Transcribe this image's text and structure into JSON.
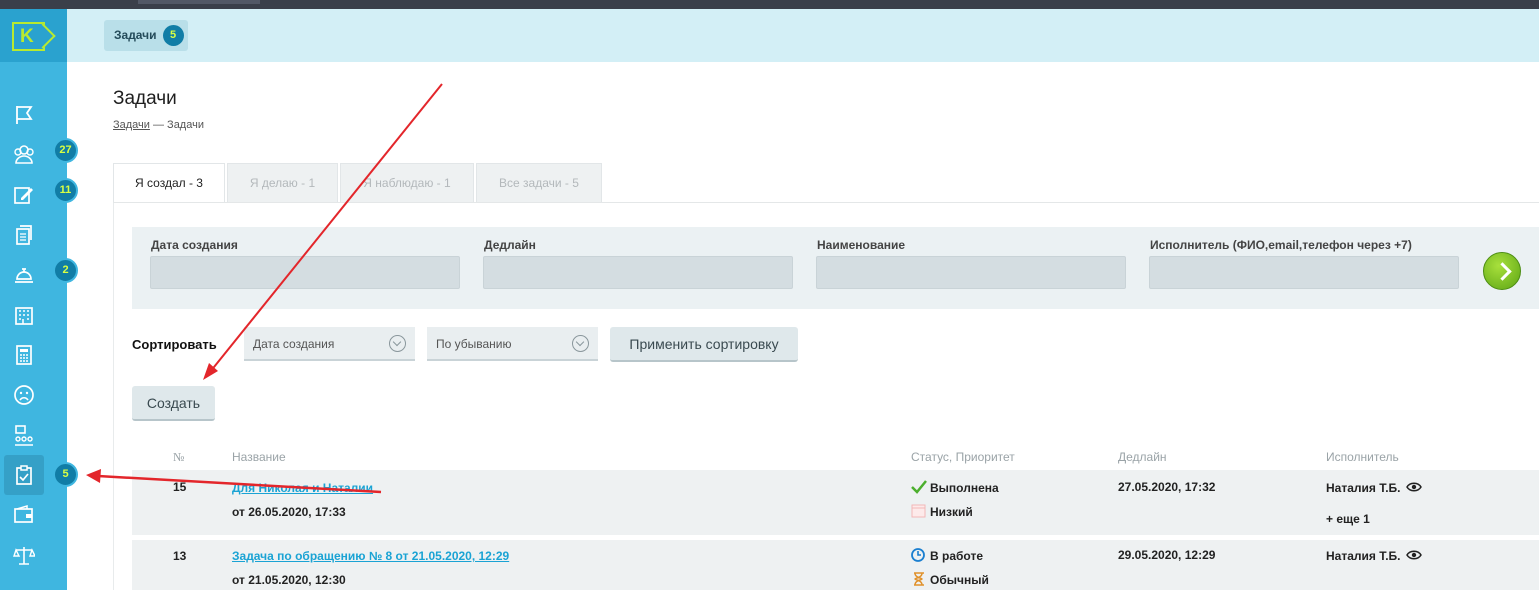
{
  "header": {
    "chip_label": "Задачи",
    "chip_count": "5"
  },
  "sidebar": {
    "logo_letter": "K",
    "items": [
      {
        "icon": "flag-icon",
        "badge": ""
      },
      {
        "icon": "users-group-icon",
        "badge": "27"
      },
      {
        "icon": "edit-note-icon",
        "badge": "11"
      },
      {
        "icon": "documents-icon",
        "badge": ""
      },
      {
        "icon": "concierge-bell-icon",
        "badge": "2"
      },
      {
        "icon": "building-icon",
        "badge": ""
      },
      {
        "icon": "calculator-icon",
        "badge": ""
      },
      {
        "icon": "sad-face-icon",
        "badge": ""
      },
      {
        "icon": "org-structure-icon",
        "badge": ""
      },
      {
        "icon": "clipboard-check-icon",
        "badge": "5"
      },
      {
        "icon": "wallet-icon",
        "badge": ""
      },
      {
        "icon": "scales-icon",
        "badge": ""
      }
    ]
  },
  "page": {
    "title": "Задачи",
    "breadcrumb_link": "Задачи",
    "breadcrumb_rest": " — Задачи"
  },
  "tabs": [
    "Я создал - 3",
    "Я делаю - 1",
    "Я наблюдаю - 1",
    "Все задачи - 5"
  ],
  "filters": {
    "created_label": "Дата создания",
    "deadline_label": "Дедлайн",
    "name_label": "Наименование",
    "assignee_label": "Исполнитель (ФИО,email,телефон через +7)"
  },
  "sort": {
    "label": "Сортировать",
    "field": "Дата создания",
    "order": "По убыванию",
    "apply_label": "Применить сортировку"
  },
  "create_label": "Создать",
  "table": {
    "headers": [
      "№",
      "Название",
      "Статус, Приоритет",
      "Дедлайн",
      "Исполнитель"
    ],
    "rows": [
      {
        "num": "15",
        "name": "Для Николая и Наталии",
        "created": "от 26.05.2020, 17:33",
        "status": "Выполнена",
        "priority": "Низкий",
        "deadline": "27.05.2020, 17:32",
        "assignee": "Наталия Т.Б.",
        "more": "+ еще 1"
      },
      {
        "num": "13",
        "name": "Задача по обращению № 8 от 21.05.2020, 12:29",
        "created": "от 21.05.2020, 12:30",
        "status": "В работе",
        "priority": "Обычный",
        "deadline": "29.05.2020, 12:29",
        "assignee": "Наталия Т.Б.",
        "more": ""
      }
    ]
  },
  "colors": {
    "sidebar": "#3fb6e0",
    "badge": "#117da6",
    "badge_text": "#d8ff43",
    "link": "#1aa3d4",
    "annotation_arrow": "#e3262b"
  }
}
